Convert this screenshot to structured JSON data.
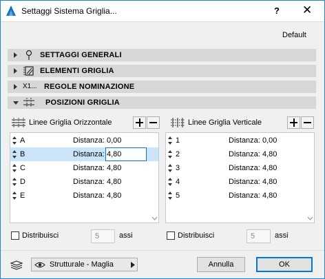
{
  "window": {
    "title": "Settaggi Sistema Griglia...",
    "help_label": "?",
    "close_label": "✕"
  },
  "default_label": "Default",
  "sections": [
    {
      "label": "SETTAGGI GENERALI",
      "icon": "pin-icon",
      "expanded": false
    },
    {
      "label": "ELEMENTI GRIGLIA",
      "icon": "grid-element-icon",
      "expanded": false
    },
    {
      "label": "REGOLE NOMINAZIONE",
      "icon": "x1-naming-icon",
      "icon_text": "X1...",
      "expanded": false
    },
    {
      "label": "POSIZIONI GRIGLIA",
      "icon": "grid-positions-icon",
      "expanded": true
    }
  ],
  "horizontal": {
    "title": "Linee Griglia Orizzontale",
    "rows": [
      {
        "name": "A",
        "label": "Distanza:",
        "value": "0,00"
      },
      {
        "name": "B",
        "label": "Distanza:",
        "value": "4,80"
      },
      {
        "name": "C",
        "label": "Distanza:",
        "value": "4,80"
      },
      {
        "name": "D",
        "label": "Distanza:",
        "value": "4,80"
      },
      {
        "name": "E",
        "label": "Distanza:",
        "value": "4,80"
      }
    ],
    "distribute_label": "Distribuisci",
    "distribute_value": "5",
    "axes_label": "assi"
  },
  "vertical": {
    "title": "Linee Griglia Verticale",
    "rows": [
      {
        "name": "1",
        "label": "Distanza:",
        "value": "0,00"
      },
      {
        "name": "2",
        "label": "Distanza:",
        "value": "4,80"
      },
      {
        "name": "3",
        "label": "Distanza:",
        "value": "4,80"
      },
      {
        "name": "4",
        "label": "Distanza:",
        "value": "4,80"
      },
      {
        "name": "5",
        "label": "Distanza:",
        "value": "4,80"
      }
    ],
    "distribute_label": "Distribuisci",
    "distribute_value": "5",
    "axes_label": "assi"
  },
  "layer": {
    "label": "Strutturale - Maglia"
  },
  "buttons": {
    "cancel": "Annulla",
    "ok": "OK"
  },
  "colors": {
    "accent": "#0078d7",
    "section_bg": "#d7d7d7",
    "selected_row": "#cce4f7"
  }
}
